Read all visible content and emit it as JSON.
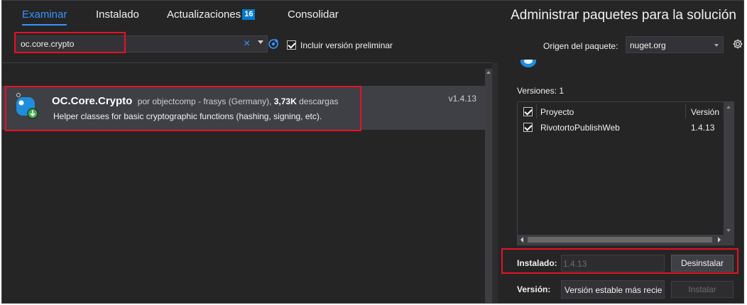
{
  "window": {
    "title": "Administrar paquetes para la solución"
  },
  "tabs": [
    {
      "label": "Examinar",
      "active": true
    },
    {
      "label": "Instalado",
      "active": false
    },
    {
      "label": "Actualizaciones",
      "badge": "16",
      "active": false
    },
    {
      "label": "Consolidar",
      "active": false
    }
  ],
  "search": {
    "value": "oc.core.crypto",
    "clear_icon": "close-icon",
    "dropdown_icon": "chevron-down-icon",
    "refresh_icon": "refresh-icon",
    "prerelease_label": "Incluir versión preliminar",
    "prerelease_checked": true
  },
  "source": {
    "label": "Origen del paquete:",
    "value": "nuget.org",
    "settings_icon": "gear-icon"
  },
  "packages": [
    {
      "name": "OC.Core.Crypto",
      "by_prefix": "por objectcomp - frasys (Germany),",
      "downloads": "3,73K",
      "downloads_suffix": "descargas",
      "description": "Helper classes for basic cryptographic functions (hashing, signing, etc).",
      "version": "v1.4.13",
      "icon": "package-icon"
    }
  ],
  "details": {
    "versions_label": "Versiones: 1",
    "grid": {
      "columns": [
        "Proyecto",
        "Versión"
      ],
      "header_checked": true,
      "rows": [
        {
          "project": "RivotortoPublishWeb",
          "version": "1.4.13",
          "checked": true
        }
      ]
    },
    "installed_label": "Instalado:",
    "installed_value": "1.4.13",
    "uninstall_label": "Desinstalar",
    "version_label": "Versión:",
    "version_value": "Versión estable más recie",
    "install_label": "Instalar"
  },
  "colors": {
    "background": "#252526",
    "accent": "#3794ff",
    "badge": "#007acc",
    "highlight": "#e81123",
    "selected_row": "#3f3f46"
  }
}
